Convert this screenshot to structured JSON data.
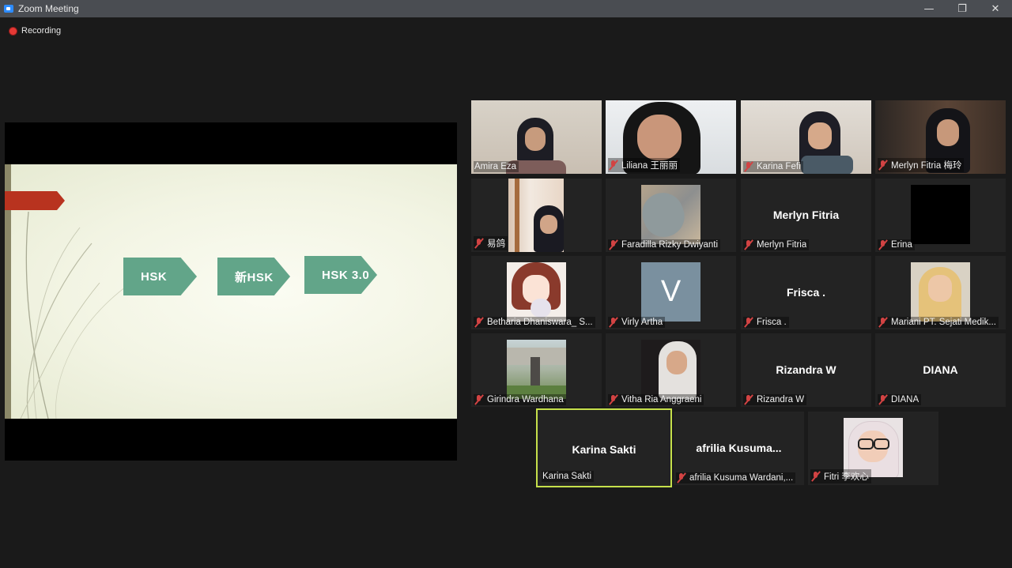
{
  "window": {
    "title": "Zoom Meeting",
    "minimize": "—",
    "maximize": "❐",
    "close": "✕"
  },
  "recording": {
    "label": "Recording"
  },
  "slide": {
    "steps": [
      "HSK",
      "新HSK",
      "HSK 3.0"
    ]
  },
  "participants": [
    {
      "name": "Amira Eza",
      "muted": false
    },
    {
      "name": "Liliana 王丽丽",
      "muted": true
    },
    {
      "name": "Karina Fefi",
      "muted": true
    },
    {
      "name": "Merlyn Fitria 梅玲",
      "muted": true
    },
    {
      "name": "易鸽",
      "muted": true
    },
    {
      "name": "Faradilla Rizky Dwiyanti",
      "muted": true
    },
    {
      "name": "Merlyn Fitria",
      "display": "Merlyn Fitria",
      "muted": true
    },
    {
      "name": "Erina",
      "muted": true
    },
    {
      "name": "Betharia Dhaniswara_ S...",
      "muted": true
    },
    {
      "name": "Virly Artha",
      "initial": "V",
      "muted": true
    },
    {
      "name": "Frisca .",
      "display": "Frisca .",
      "muted": true
    },
    {
      "name": "Mariani PT. Sejati Medik...",
      "muted": true
    },
    {
      "name": "Girindra Wardhana",
      "muted": true
    },
    {
      "name": "Vitha Ria Anggraeni",
      "muted": true
    },
    {
      "name": "Rizandra W",
      "display": "Rizandra W",
      "muted": true
    },
    {
      "name": "DIANA",
      "display": "DIANA",
      "muted": true
    },
    {
      "name": "Karina Sakti",
      "display": "Karina Sakti",
      "muted": false,
      "active": true
    },
    {
      "name": "afrilia Kusuma Wardani,...",
      "display": "afrilia  Kusuma...",
      "muted": true
    },
    {
      "name": "Fitri 李欢心",
      "muted": true
    }
  ]
}
